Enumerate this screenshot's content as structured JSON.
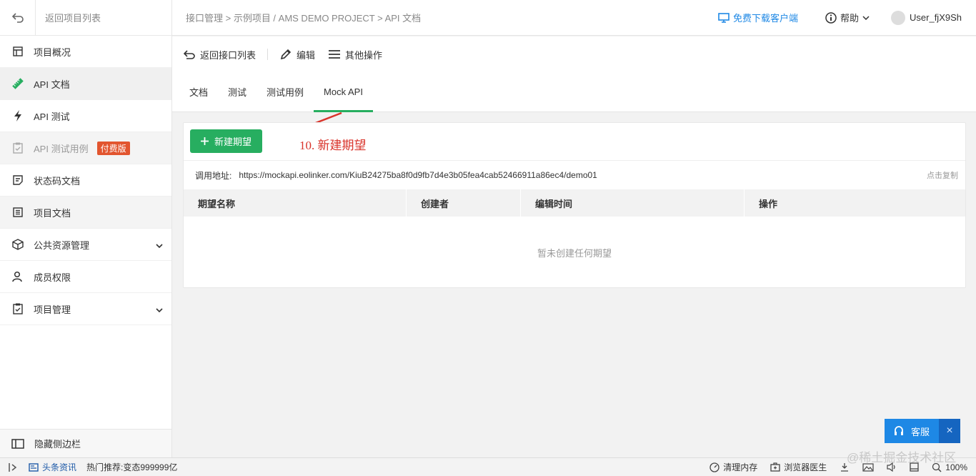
{
  "sidebar": {
    "back_label": "返回项目列表",
    "items": [
      {
        "label": "项目概况"
      },
      {
        "label": "API 文档"
      },
      {
        "label": "API 测试"
      },
      {
        "label": "API 测试用例",
        "badge": "付费版"
      },
      {
        "label": "状态码文档"
      },
      {
        "label": "项目文档"
      },
      {
        "label": "公共资源管理"
      },
      {
        "label": "成员权限"
      },
      {
        "label": "项目管理"
      }
    ],
    "hide_label": "隐藏侧边栏"
  },
  "header": {
    "breadcrumb": "接口管理 > 示例项目 / AMS DEMO PROJECT > API 文档",
    "download": "免费下载客户端",
    "help": "帮助",
    "username": "User_fjX9Sh"
  },
  "toolbar": {
    "back": "返回接口列表",
    "edit": "编辑",
    "more": "其他操作"
  },
  "tabs": [
    {
      "label": "文档"
    },
    {
      "label": "测试"
    },
    {
      "label": "测试用例"
    },
    {
      "label": "Mock API"
    }
  ],
  "mock": {
    "new_button": "新建期望",
    "annotation": "10. 新建期望",
    "call_label": "调用地址:",
    "call_url": "https://mockapi.eolinker.com/KiuB24275ba8f0d9fb7d4e3b05fea4cab52466911a86ec4/demo01",
    "copy": "点击复制",
    "columns": [
      "期望名称",
      "创建者",
      "编辑时间",
      "操作"
    ],
    "empty": "暂未创建任何期望"
  },
  "service": {
    "label": "客服",
    "close": "×"
  },
  "statusbar": {
    "news": "头条资讯",
    "hot": "热门推荐:变态999999亿",
    "clean": "清理内存",
    "doctor": "浏览器医生",
    "zoom": "100%"
  },
  "watermark": "@稀土掘金技术社区",
  "colors": {
    "accent": "#27ae60",
    "link": "#1e88e5",
    "badge": "#e2552f",
    "annotation": "#d9342b"
  }
}
